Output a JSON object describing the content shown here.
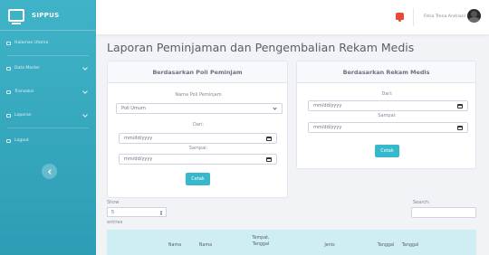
{
  "brand": {
    "name": "SIPPUS",
    "icon": "monitor-icon"
  },
  "sidebar": {
    "items": [
      {
        "label": "Halaman Utama",
        "icon": "dashboard-icon",
        "has_chevron": false
      },
      {
        "label": "Data Master",
        "icon": "folder-icon",
        "has_chevron": true
      },
      {
        "label": "Transaksi",
        "icon": "exchange-icon",
        "has_chevron": true
      },
      {
        "label": "Laporan",
        "icon": "report-icon",
        "has_chevron": true
      },
      {
        "label": "Logout",
        "icon": "logout-icon",
        "has_chevron": false
      }
    ],
    "toggle_icon": "chevron-left-icon"
  },
  "topbar": {
    "notification_icon": "bell-icon",
    "notification_color": "#e74a3b",
    "user_name": "Fitria Trena Andriani"
  },
  "page": {
    "title": "Laporan Peminjaman dan Pengembalian Rekam Medis"
  },
  "card_poli": {
    "header": "Berdasarkan Poli Peminjam",
    "poli_label": "Nama Poli Peminjam",
    "poli_value": "Poli Umum",
    "dari_label": "Dari:",
    "dari_placeholder": "mm/dd/yyyy",
    "sampai_label": "Sampai:",
    "sampai_placeholder": "mm/dd/yyyy",
    "button": "Cetak"
  },
  "card_rekam": {
    "header": "Berdasarkan Rekam Medis",
    "dari_label": "Dari:",
    "dari_placeholder": "mm/dd/yyyy",
    "sampai_label": "Sampai:",
    "sampai_placeholder": "mm/dd/yyyy",
    "button": "Cetak"
  },
  "table_controls": {
    "show_label": "Show",
    "show_value": "5",
    "entries_label": "entries",
    "search_label": "Search:"
  },
  "table": {
    "columns": [
      {
        "line1": "",
        "line2": "Nama"
      },
      {
        "line1": "",
        "line2": "Nama"
      },
      {
        "line1": "Tempat,",
        "line2": "Tanggal"
      },
      {
        "line1": "",
        "line2": "Jenis"
      },
      {
        "line1": "",
        "line2": "Tanggal"
      },
      {
        "line1": "",
        "line2": "Tanggal"
      }
    ]
  },
  "colors": {
    "sidebar": "#36b9cc",
    "accent": "#36b9cc",
    "table_header": "#cfeef3"
  }
}
